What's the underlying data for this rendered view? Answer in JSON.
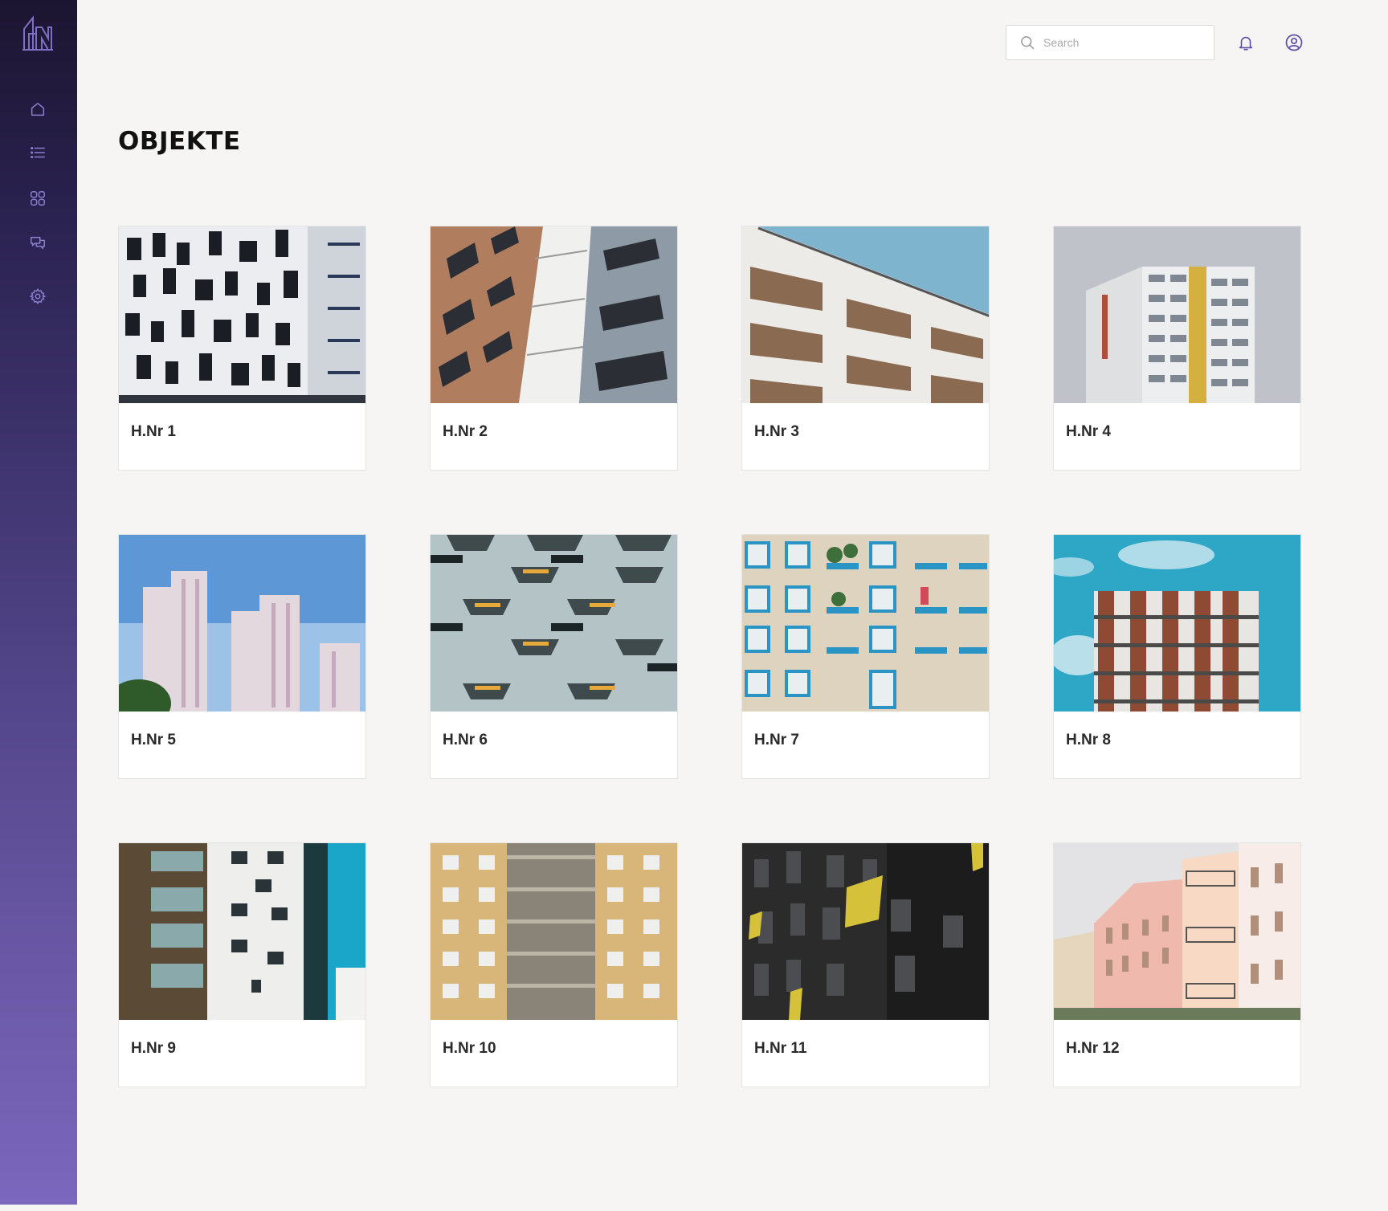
{
  "sidebar": {
    "logo": "building-logo",
    "items": [
      {
        "name": "home",
        "icon": "home-icon"
      },
      {
        "name": "list",
        "icon": "list-icon"
      },
      {
        "name": "grid",
        "icon": "grid-icon"
      },
      {
        "name": "messages",
        "icon": "chat-icon"
      },
      {
        "name": "settings",
        "icon": "gear-icon"
      }
    ],
    "accent": "#7b67bd"
  },
  "header": {
    "search_placeholder": "Search",
    "notification_icon": "bell-icon",
    "profile_icon": "user-circle-icon"
  },
  "main": {
    "title": "OBJEKTE",
    "objects": [
      {
        "label": "H.Nr 1"
      },
      {
        "label": "H.Nr 2"
      },
      {
        "label": "H.Nr 3"
      },
      {
        "label": "H.Nr 4"
      },
      {
        "label": "H.Nr 5"
      },
      {
        "label": "H.Nr 6"
      },
      {
        "label": "H.Nr 7"
      },
      {
        "label": "H.Nr 8"
      },
      {
        "label": "H.Nr 9"
      },
      {
        "label": "H.Nr 10"
      },
      {
        "label": "H.Nr 11"
      },
      {
        "label": "H.Nr 12"
      }
    ]
  }
}
